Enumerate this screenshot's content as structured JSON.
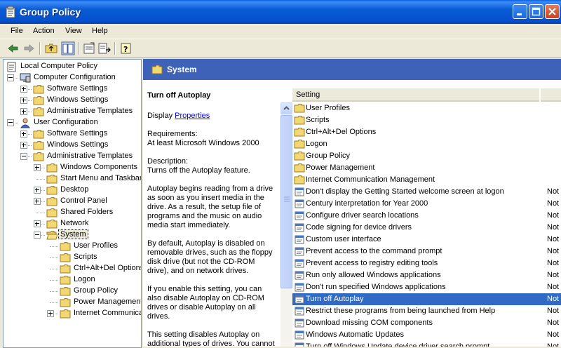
{
  "window": {
    "title": "Group Policy"
  },
  "menu": [
    "File",
    "Action",
    "View",
    "Help"
  ],
  "tree": [
    {
      "label": "Local Computer Policy",
      "depth": 0,
      "icon": "policy-icon",
      "exp": ""
    },
    {
      "label": "Computer Configuration",
      "depth": 1,
      "icon": "computer-icon",
      "exp": "minus"
    },
    {
      "label": "Software Settings",
      "depth": 2,
      "icon": "folder-icon",
      "exp": "plus"
    },
    {
      "label": "Windows Settings",
      "depth": 2,
      "icon": "folder-icon",
      "exp": "plus"
    },
    {
      "label": "Administrative Templates",
      "depth": 2,
      "icon": "folder-icon",
      "exp": "plus"
    },
    {
      "label": "User Configuration",
      "depth": 1,
      "icon": "user-icon",
      "exp": "minus"
    },
    {
      "label": "Software Settings",
      "depth": 2,
      "icon": "folder-icon",
      "exp": "plus"
    },
    {
      "label": "Windows Settings",
      "depth": 2,
      "icon": "folder-icon",
      "exp": "plus"
    },
    {
      "label": "Administrative Templates",
      "depth": 2,
      "icon": "folder-icon",
      "exp": "minus"
    },
    {
      "label": "Windows Components",
      "depth": 3,
      "icon": "folder-icon",
      "exp": "plus"
    },
    {
      "label": "Start Menu and Taskbar",
      "depth": 3,
      "icon": "folder-icon",
      "exp": ""
    },
    {
      "label": "Desktop",
      "depth": 3,
      "icon": "folder-icon",
      "exp": "plus"
    },
    {
      "label": "Control Panel",
      "depth": 3,
      "icon": "folder-icon",
      "exp": "plus"
    },
    {
      "label": "Shared Folders",
      "depth": 3,
      "icon": "folder-icon",
      "exp": ""
    },
    {
      "label": "Network",
      "depth": 3,
      "icon": "folder-icon",
      "exp": "plus"
    },
    {
      "label": "System",
      "depth": 3,
      "icon": "open-folder-icon",
      "exp": "minus",
      "selected": true
    },
    {
      "label": "User Profiles",
      "depth": 4,
      "icon": "folder-icon",
      "exp": ""
    },
    {
      "label": "Scripts",
      "depth": 4,
      "icon": "folder-icon",
      "exp": ""
    },
    {
      "label": "Ctrl+Alt+Del Options",
      "depth": 4,
      "icon": "folder-icon",
      "exp": ""
    },
    {
      "label": "Logon",
      "depth": 4,
      "icon": "folder-icon",
      "exp": ""
    },
    {
      "label": "Group Policy",
      "depth": 4,
      "icon": "folder-icon",
      "exp": ""
    },
    {
      "label": "Power Management",
      "depth": 4,
      "icon": "folder-icon",
      "exp": ""
    },
    {
      "label": "Internet Communication Management",
      "depth": 4,
      "icon": "folder-icon",
      "exp": "plus"
    }
  ],
  "right": {
    "header": "System",
    "description": {
      "title": "Turn off Autoplay",
      "display_prefix": "Display ",
      "display_link": "Properties",
      "requirements_label": "Requirements:",
      "requirements": "At least Microsoft Windows 2000",
      "description_label": "Description:",
      "p1": "Turns off the Autoplay feature.",
      "p2": "Autoplay begins reading from a drive as soon as you insert media in the drive. As a result, the setup file of programs and the music on audio media start immediately.",
      "p3": "By default, Autoplay is disabled on removable drives, such as the floppy disk drive (but not the CD-ROM drive), and on network drives.",
      "p4": "If you enable this setting, you can also disable Autoplay on CD-ROM drives or disable Autoplay on all drives.",
      "p5": "This setting disables Autoplay on additional types of drives. You cannot"
    },
    "columns": {
      "setting": "Setting",
      "state": ""
    },
    "settings": [
      {
        "name": "User Profiles",
        "type": "folder",
        "state": ""
      },
      {
        "name": "Scripts",
        "type": "folder",
        "state": ""
      },
      {
        "name": "Ctrl+Alt+Del Options",
        "type": "folder",
        "state": ""
      },
      {
        "name": "Logon",
        "type": "folder",
        "state": ""
      },
      {
        "name": "Group Policy",
        "type": "folder",
        "state": ""
      },
      {
        "name": "Power Management",
        "type": "folder",
        "state": ""
      },
      {
        "name": "Internet Communication Management",
        "type": "folder",
        "state": ""
      },
      {
        "name": "Don't display the Getting Started welcome screen at logon",
        "type": "setting",
        "state": "Not"
      },
      {
        "name": "Century interpretation for Year 2000",
        "type": "setting",
        "state": "Not"
      },
      {
        "name": "Configure driver search locations",
        "type": "setting",
        "state": "Not"
      },
      {
        "name": "Code signing for device drivers",
        "type": "setting",
        "state": "Not"
      },
      {
        "name": "Custom user interface",
        "type": "setting",
        "state": "Not"
      },
      {
        "name": "Prevent access to the command prompt",
        "type": "setting",
        "state": "Not"
      },
      {
        "name": "Prevent access to registry editing tools",
        "type": "setting",
        "state": "Not"
      },
      {
        "name": "Run only allowed Windows applications",
        "type": "setting",
        "state": "Not"
      },
      {
        "name": "Don't run specified Windows applications",
        "type": "setting",
        "state": "Not"
      },
      {
        "name": "Turn off Autoplay",
        "type": "setting",
        "state": "Not",
        "selected": true
      },
      {
        "name": "Restrict these programs from being launched from Help",
        "type": "setting",
        "state": "Not"
      },
      {
        "name": "Download missing COM components",
        "type": "setting",
        "state": "Not"
      },
      {
        "name": "Windows Automatic Updates",
        "type": "setting",
        "state": "Not"
      },
      {
        "name": "Turn off Windows Update device driver search prompt",
        "type": "setting",
        "state": "Not"
      }
    ]
  },
  "colors": {
    "titlebar": "#0a5ad6",
    "header": "#3d62b8",
    "selection": "#316ac5",
    "link": "#0000ff"
  }
}
